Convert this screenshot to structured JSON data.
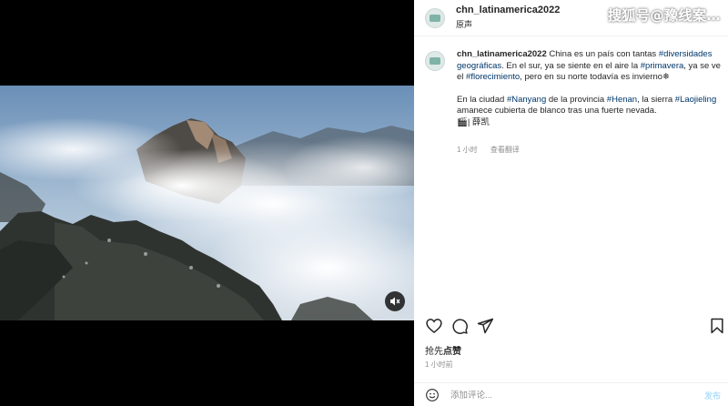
{
  "watermark": "搜狐号@豫线案…",
  "post": {
    "username": "chn_latinamerica2022",
    "location": "原声",
    "caption": {
      "username": "chn_latinamerica2022",
      "p1_a": "China es un país con tantas ",
      "tag_diversidades": "#diversidades geográficas",
      "p1_b": ". En el sur, ya se siente en el aire la ",
      "tag_primavera": "#primavera",
      "p1_c": ", ya se ve el ",
      "tag_florecimiento": "#florecimiento",
      "p1_d": ", pero en su norte todavía es invierno❄",
      "p2_a": "En la ciudad ",
      "tag_nanyang": "#Nanyang",
      "p2_b": " de la provincia ",
      "tag_henan": "#Henan",
      "p2_c": ", la sierra ",
      "tag_laojieling": "#Laojieling",
      "p2_d": " amanece cubierta de blanco tras una fuerte nevada.",
      "p3": "🎬| 薛凯"
    },
    "meta": {
      "time": "1 小时",
      "translate": "查看翻译"
    },
    "likes_prefix": "抢先",
    "likes_action": "点赞",
    "timestamp": "1 小时前"
  },
  "comment": {
    "placeholder": "添加评论...",
    "post_label": "发布"
  },
  "icons": {
    "mute": "volume-mute-icon",
    "more": "more-options-icon",
    "like": "heart-icon",
    "comment": "comment-icon",
    "share": "send-icon",
    "save": "bookmark-icon",
    "emoji": "emoji-icon"
  }
}
